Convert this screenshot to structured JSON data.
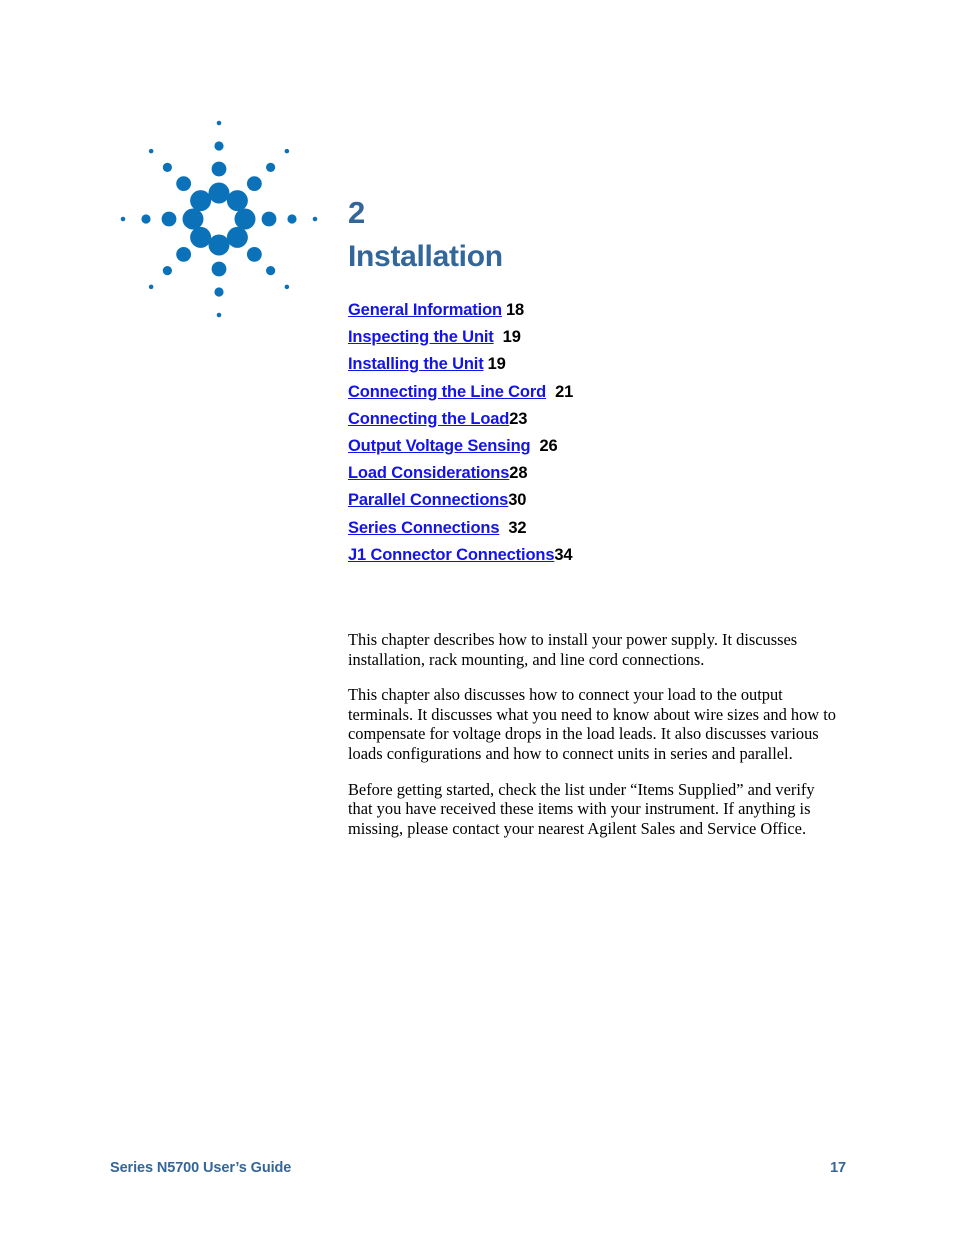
{
  "colors": {
    "logo_blue": "#0b72b9",
    "heading_blue": "#336699",
    "link_blue": "#1414e6",
    "body_black": "#000000"
  },
  "logo": {
    "name": "agilent-ping-starburst-logo",
    "description": "Eight-ray starburst of blue dots, dots grow larger toward the center, center empty"
  },
  "chapter": {
    "number": "2",
    "title": "Installation"
  },
  "toc": {
    "items": [
      {
        "label": "General Information",
        "page": "18",
        "gap": "gap-sm"
      },
      {
        "label": "Inspecting the Unit",
        "page": "19",
        "gap": "gap-md"
      },
      {
        "label": "Installing the Unit",
        "page": "19",
        "gap": "gap-sm"
      },
      {
        "label": "Connecting the Line Cord",
        "page": "21",
        "gap": "gap-md"
      },
      {
        "label": "Connecting the Load",
        "page": "23",
        "gap": "gap-none"
      },
      {
        "label": "Output Voltage Sensing",
        "page": "26",
        "gap": "gap-md"
      },
      {
        "label": "Load Considerations",
        "page": "28",
        "gap": "gap-none"
      },
      {
        "label": "Parallel Connections",
        "page": "30",
        "gap": "gap-none"
      },
      {
        "label": "Series Connections",
        "page": "32",
        "gap": "gap-md"
      },
      {
        "label": "J1 Connector Connections",
        "page": "34",
        "gap": "gap-none"
      }
    ]
  },
  "body": {
    "paragraphs": [
      "This chapter describes how to install your power supply. It discusses installation, rack mounting, and line cord connections.",
      "This chapter also discusses how to connect your load to the output terminals. It discusses what you need to know about wire sizes and how to compensate for voltage drops in the load leads. It also discusses various loads configurations and how to connect units in series and parallel.",
      "Before getting started, check the list under “Items Supplied” and verify that you have received these items with your instrument. If anything is missing, please contact your nearest Agilent Sales and Service Office."
    ]
  },
  "footer": {
    "guide_title": "Series N5700 User’s Guide",
    "page_number": "17"
  }
}
